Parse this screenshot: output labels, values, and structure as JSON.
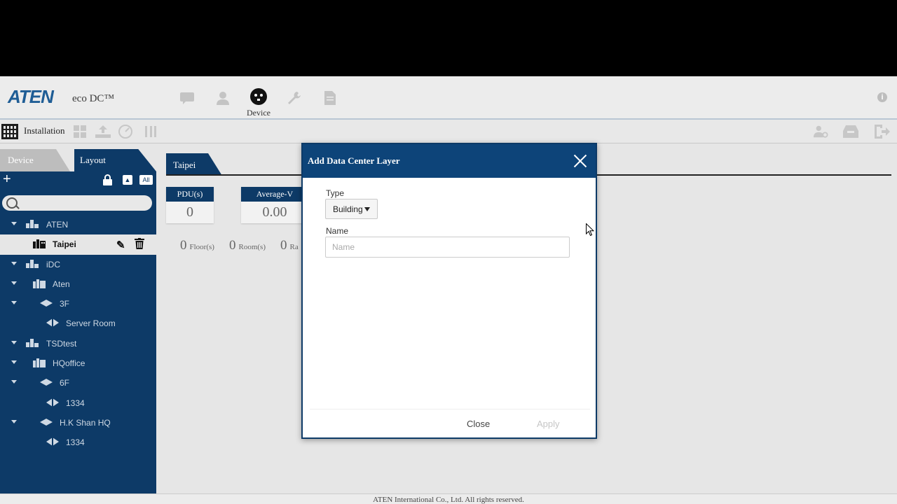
{
  "header": {
    "brand": "ATEN",
    "product": "eco DC™",
    "active_nav_label": "Device",
    "nav_icons": [
      "comment-icon",
      "user-icon",
      "outlet-icon",
      "wrench-icon",
      "document-icon"
    ],
    "info_symbol": "i"
  },
  "subbar": {
    "label": "Installation",
    "icons": [
      "grid-icon",
      "dashboard-icon",
      "upload-icon",
      "gauge-icon",
      "tools-icon"
    ],
    "right_icons": [
      "user-settings-icon",
      "inbox-icon",
      "logout-icon"
    ]
  },
  "sidebar": {
    "tabs": [
      "Device",
      "Layout"
    ],
    "active_tab": "Layout",
    "all_label": "All",
    "search_value": "",
    "tree": [
      {
        "label": "ATEN",
        "level": 0,
        "type": "organization",
        "expanded": true
      },
      {
        "label": "Taipei",
        "level": 1,
        "type": "building",
        "selected": true
      },
      {
        "label": "iDC",
        "level": 0,
        "type": "organization",
        "expanded": true
      },
      {
        "label": "Aten",
        "level": 1,
        "type": "building",
        "expanded": true
      },
      {
        "label": "3F",
        "level": 2,
        "type": "floor",
        "expanded": true
      },
      {
        "label": "Server Room",
        "level": 3,
        "type": "room"
      },
      {
        "label": "TSDtest",
        "level": 0,
        "type": "organization",
        "expanded": true
      },
      {
        "label": "HQoffice",
        "level": 1,
        "type": "building",
        "expanded": true
      },
      {
        "label": "6F",
        "level": 2,
        "type": "floor",
        "expanded": true
      },
      {
        "label": "1334",
        "level": 3,
        "type": "room"
      },
      {
        "label": "H.K Shan HQ",
        "level": 2,
        "type": "floor",
        "expanded": true
      },
      {
        "label": "1334",
        "level": 3,
        "type": "room"
      }
    ]
  },
  "main": {
    "tab": "Taipei",
    "cards": [
      {
        "header": "PDU(s)",
        "value": "0"
      },
      {
        "header": "Average-V",
        "value": "0.00"
      }
    ],
    "counts": [
      {
        "value": "0",
        "unit": "Floor(s)"
      },
      {
        "value": "0",
        "unit": "Room(s)"
      },
      {
        "value": "0",
        "unit": "Ra"
      }
    ]
  },
  "modal": {
    "title": "Add Data Center Layer",
    "type_label": "Type",
    "type_value": "Building",
    "name_label": "Name",
    "name_placeholder": "Name",
    "name_value": "",
    "close_label": "Close",
    "apply_label": "Apply",
    "apply_enabled": false
  },
  "footer": {
    "text": "ATEN International Co., Ltd. All rights reserved."
  },
  "colors": {
    "navy": "#0d3a67",
    "modal_header": "#0d4479",
    "brand_blue": "#1f5d95"
  }
}
